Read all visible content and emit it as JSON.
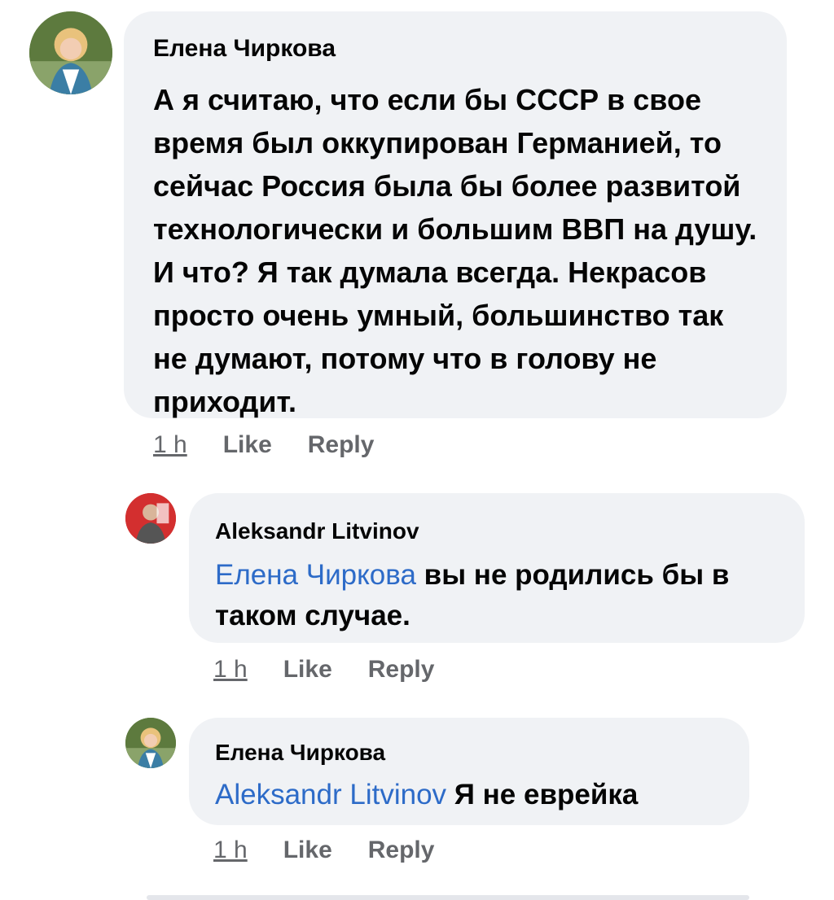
{
  "comments": [
    {
      "author": "Елена Чиркова",
      "mention": "",
      "text": "А я считаю, что если бы СССР в свое время был оккупирован Германией, то сейчас Россия была бы более развитой технологически и большим ВВП на душу. И что? Я так думала всегда. Некрасов просто очень умный, большинство так не думают, потому что в голову не приходит.",
      "time": "1 h",
      "like": "Like",
      "reply": "Reply"
    },
    {
      "author": "Aleksandr Litvinov",
      "mention": "Елена Чиркова",
      "text": "вы не родились бы в таком случае.",
      "time": "1 h",
      "like": "Like",
      "reply": "Reply"
    },
    {
      "author": "Елена Чиркова",
      "mention": "Aleksandr Litvinov",
      "text": "Я не еврейка",
      "time": "1 h",
      "like": "Like",
      "reply": "Reply"
    }
  ],
  "colors": {
    "bubble": "#f0f2f5",
    "mention": "#2d6bc8",
    "meta": "#65676b"
  }
}
